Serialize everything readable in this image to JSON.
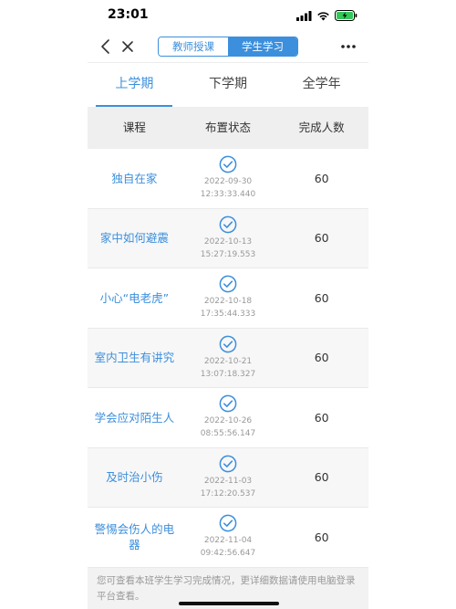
{
  "status_bar": {
    "time": "23:01"
  },
  "nav": {
    "segments": [
      {
        "label": "教师授课",
        "active": false
      },
      {
        "label": "学生学习",
        "active": true
      }
    ]
  },
  "tabs": [
    {
      "label": "上学期",
      "selected": true
    },
    {
      "label": "下学期",
      "selected": false
    },
    {
      "label": "全学年",
      "selected": false
    }
  ],
  "table": {
    "headers": [
      "课程",
      "布置状态",
      "完成人数"
    ],
    "rows": [
      {
        "course": "独自在家",
        "date": "2022-09-30",
        "time": "12:33:33.440",
        "count": "60"
      },
      {
        "course": "家中如何避震",
        "date": "2022-10-13",
        "time": "15:27:19.553",
        "count": "60"
      },
      {
        "course": "小心“电老虎”",
        "date": "2022-10-18",
        "time": "17:35:44.333",
        "count": "60"
      },
      {
        "course": "室内卫生有讲究",
        "date": "2022-10-21",
        "time": "13:07:18.327",
        "count": "60"
      },
      {
        "course": "学会应对陌生人",
        "date": "2022-10-26",
        "time": "08:55:56.147",
        "count": "60"
      },
      {
        "course": "及时治小伤",
        "date": "2022-11-03",
        "time": "17:12:20.537",
        "count": "60"
      },
      {
        "course": "警惕会伤人的电器",
        "date": "2022-11-04",
        "time": "09:42:56.647",
        "count": "60"
      }
    ]
  },
  "footer_note": "您可查看本班学生学习完成情况，更详细数据请使用电脑登录平台查看。",
  "colors": {
    "accent": "#3c8fdc",
    "header_bg": "#efefef"
  },
  "icons": {
    "check": "check-circle-icon",
    "back": "chevron-left-icon",
    "close": "close-icon",
    "more": "more-icon"
  }
}
